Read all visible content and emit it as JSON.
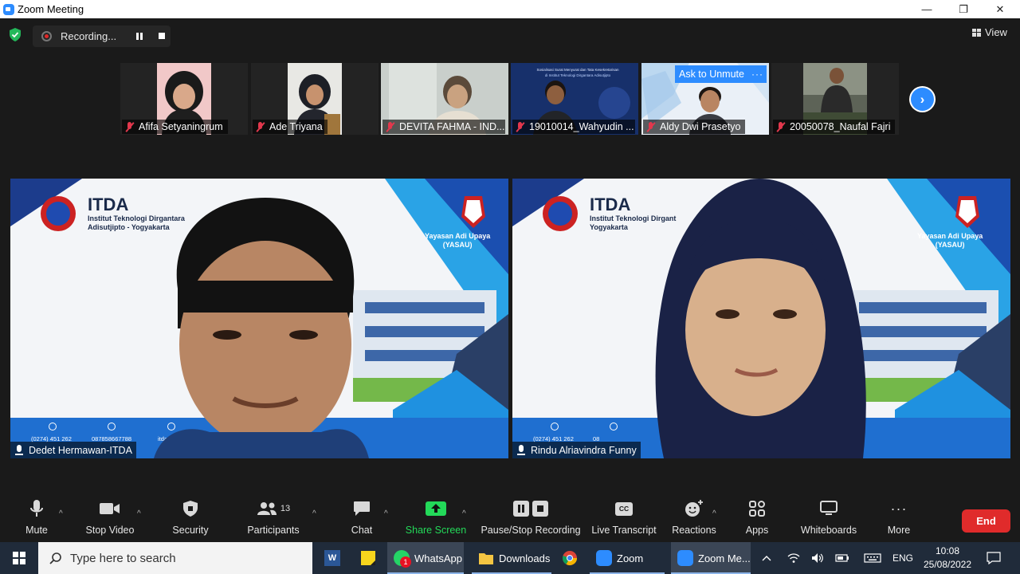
{
  "window": {
    "title": "Zoom Meeting",
    "minimize_glyph": "—",
    "restore_glyph": "❐",
    "close_glyph": "✕"
  },
  "recording": {
    "label": "Recording..."
  },
  "view_button": {
    "label": "View"
  },
  "thumbnails": [
    {
      "name": "Afifa Setyaningrum",
      "muted": true
    },
    {
      "name": "Ade Triyana",
      "muted": true
    },
    {
      "name": "DEVITA FAHMA - IND...",
      "muted": true
    },
    {
      "name": "19010014_Wahyudin ...",
      "muted": true
    },
    {
      "name": "Aldy Dwi Prasetyo",
      "muted": true
    },
    {
      "name": "20050078_Naufal Fajri",
      "muted": true
    }
  ],
  "ask_to_unmute": {
    "label": "Ask to Unmute",
    "more": "···"
  },
  "slide_text": {
    "line1": "Sosialisasi Surat Menyurat dan Tata Kesekretarisan",
    "line2": "di Institut Teknologi Dirgantara Adisutjipto"
  },
  "next_page": {
    "glyph": "›"
  },
  "main_videos": [
    {
      "name": "Dedet Hermawan-ITDA",
      "brand_title": "ITDA",
      "brand_sub": "Institut Teknologi Dirgantara\nAdisutjipto - Yogyakarta",
      "foundation": "Yayasan Adi Upaya\n(YASAU)",
      "phone": "(0274) 451 262",
      "whatsapp": "087858667788",
      "website": "itda.ac.id"
    },
    {
      "name": "Rindu Alriavindra Funny",
      "brand_title": "ITDA",
      "brand_sub": "Institut Teknologi Dirgant\nYogyakarta",
      "foundation": "Yayasan Adi Upaya\n(YASAU)",
      "phone": "(0274) 451 262",
      "whatsapp": "08"
    }
  ],
  "toolbar": {
    "mute": "Mute",
    "stop_video": "Stop Video",
    "security": "Security",
    "participants": "Participants",
    "participants_count": "13",
    "chat": "Chat",
    "share_screen": "Share Screen",
    "pause_stop_recording": "Pause/Stop Recording",
    "live_transcript": "Live Transcript",
    "cc_badge": "CC",
    "reactions": "Reactions",
    "apps": "Apps",
    "whiteboards": "Whiteboards",
    "more": "More",
    "more_glyph": "···",
    "end": "End",
    "caret": "^"
  },
  "taskbar": {
    "search_placeholder": "Type here to search",
    "apps": [
      {
        "label": "WhatsApp",
        "badge": "1"
      },
      {
        "label": "Downloads"
      },
      {
        "label": "Zoom"
      },
      {
        "label": "Zoom Me..."
      }
    ],
    "word_letter": "W",
    "language": "ENG",
    "time": "10:08",
    "date": "25/08/2022"
  },
  "colors": {
    "zoom_blue": "#2d8cff",
    "end_red": "#e02b2b",
    "share_green": "#23d959",
    "muted_red": "#e2384d"
  },
  "icons": [
    "shield-check-icon",
    "record-dot-icon",
    "pause-icon",
    "stop-icon",
    "grid-view-icon",
    "mic-muted-icon",
    "chevron-right-icon",
    "microphone-icon",
    "video-camera-icon",
    "security-shield-icon",
    "participants-icon",
    "chat-bubble-icon",
    "share-arrow-icon",
    "closed-caption-icon",
    "reactions-icon",
    "apps-icon",
    "whiteboard-icon",
    "more-dots-icon",
    "windows-start-icon",
    "search-icon",
    "word-icon",
    "sticky-notes-icon",
    "whatsapp-icon",
    "folder-icon",
    "chrome-icon",
    "zoom-icon",
    "tray-chevron-icon",
    "wifi-icon",
    "speaker-icon",
    "battery-icon",
    "keyboard-icon",
    "notification-icon"
  ]
}
